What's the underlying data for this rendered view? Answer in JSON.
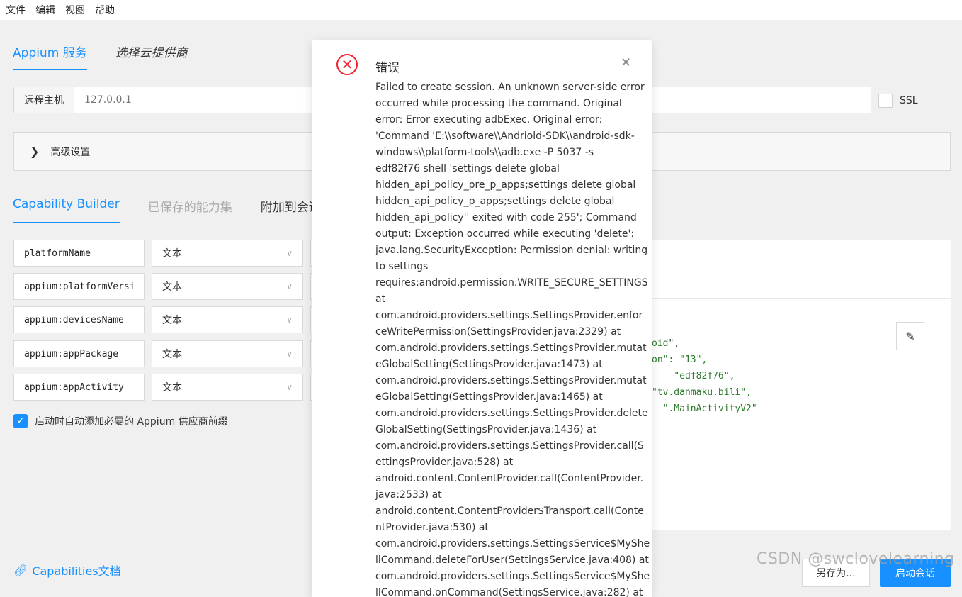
{
  "menubar": {
    "file": "文件",
    "edit": "编辑",
    "view": "视图",
    "help": "帮助"
  },
  "server_tabs": {
    "appium": "Appium 服务",
    "cloud": "选择云提供商"
  },
  "remote_host": {
    "label": "远程主机",
    "placeholder": "127.0.0.1"
  },
  "ssl_label": "SSL",
  "advanced_label": "高级设置",
  "cap_tabs": {
    "builder": "Capability Builder",
    "saved": "已保存的能力集",
    "attach": "附加到会话"
  },
  "capabilities": [
    {
      "name": "platformName",
      "type": "文本"
    },
    {
      "name": "appium:platformVersi",
      "type": "文本"
    },
    {
      "name": "appium:devicesName",
      "type": "文本"
    },
    {
      "name": "appium:appPackage",
      "type": "文本"
    },
    {
      "name": "appium:appActivity",
      "type": "文本"
    }
  ],
  "auto_prefix_label": "启动时自动添加必要的 Appium 供应商前缀",
  "json_preview": {
    "line1_key": "oid",
    "line1_tail": "\",",
    "line2_key": "on\": ",
    "line2_val": "\"13\",",
    "line3_key": "",
    "line3_val": "\"edf82f76\",",
    "line4_key": "",
    "line4_val": "\"tv.danmaku.bili\",",
    "line5_key": "",
    "line5_val": "\".MainActivityV2\""
  },
  "doc_link": "Capabilities文档",
  "save_as": "另存为...",
  "start_session": "启动会话",
  "watermark": "CSDN @swclovelearning",
  "modal": {
    "title": "错误",
    "lines": [
      "Failed to create session. An unknown server-side error",
      "occurred while processing the command. Original",
      "error: Error executing adbExec. Original error:",
      "'Command 'E:\\\\software\\\\Andriold-SDK\\\\android-sdk-",
      "windows\\\\platform-tools\\\\adb.exe -P 5037 -s",
      "edf82f76 shell 'settings delete global",
      "hidden_api_policy_pre_p_apps;settings delete global",
      "hidden_api_policy_p_apps;settings delete global",
      "hidden_api_policy'' exited with code 255'; Command",
      "output: Exception occurred while executing 'delete':",
      "java.lang.SecurityException: Permission denial: writing",
      "to settings",
      "requires:android.permission.WRITE_SECURE_SETTINGS",
      "at",
      "com.android.providers.settings.SettingsProvider.enfor",
      "ceWritePermission(SettingsProvider.java:2329) at",
      "com.android.providers.settings.SettingsProvider.mutat",
      "eGlobalSetting(SettingsProvider.java:1473) at",
      "com.android.providers.settings.SettingsProvider.mutat",
      "eGlobalSetting(SettingsProvider.java:1465) at",
      "com.android.providers.settings.SettingsProvider.delete",
      "GlobalSetting(SettingsProvider.java:1436) at",
      "com.android.providers.settings.SettingsProvider.call(S",
      "ettingsProvider.java:528) at",
      "android.content.ContentProvider.call(ContentProvider.",
      "java:2533) at",
      "android.content.ContentProvider$Transport.call(Conte",
      "ntProvider.java:530) at",
      "com.android.providers.settings.SettingsService$MyShe",
      "llCommand.deleteForUser(SettingsService.java:408) at",
      "com.android.providers.settings.SettingsService$MyShe",
      "llCommand.onCommand(SettingsService.java:282) at"
    ]
  }
}
